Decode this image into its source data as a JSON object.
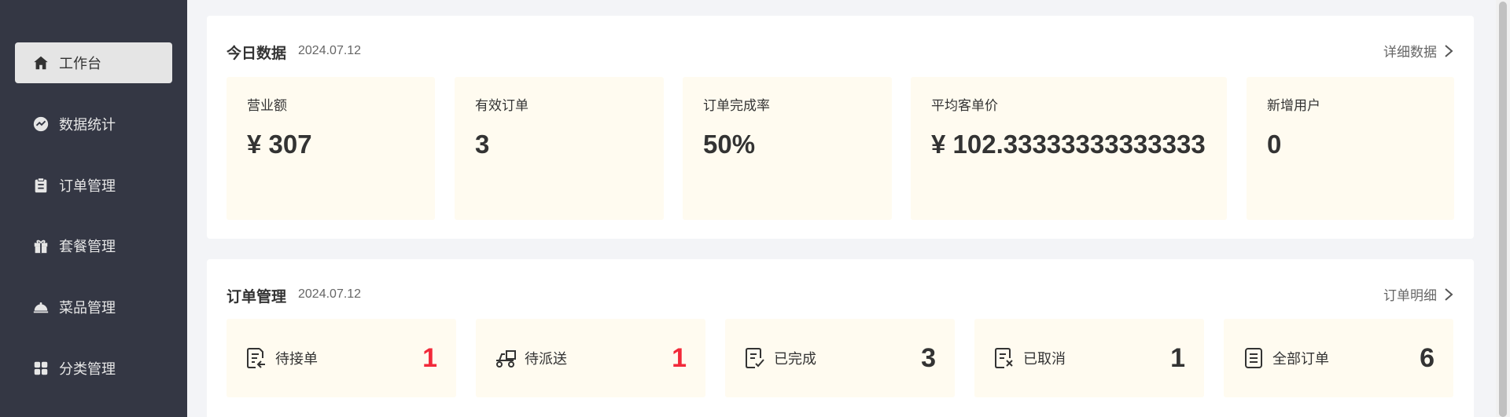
{
  "sidebar": {
    "items": [
      {
        "label": "工作台",
        "icon": "home-icon"
      },
      {
        "label": "数据统计",
        "icon": "chart-icon"
      },
      {
        "label": "订单管理",
        "icon": "clipboard-icon"
      },
      {
        "label": "套餐管理",
        "icon": "gift-icon"
      },
      {
        "label": "菜品管理",
        "icon": "dish-icon"
      },
      {
        "label": "分类管理",
        "icon": "grid-icon"
      }
    ]
  },
  "today": {
    "title": "今日数据",
    "date": "2024.07.12",
    "link": "详细数据",
    "stats": [
      {
        "label": "营业额",
        "value": "¥ 307"
      },
      {
        "label": "有效订单",
        "value": "3"
      },
      {
        "label": "订单完成率",
        "value": "50%"
      },
      {
        "label": "平均客单价",
        "value": "¥ 102.33333333333333"
      },
      {
        "label": "新增用户",
        "value": "0"
      }
    ]
  },
  "orders": {
    "title": "订单管理",
    "date": "2024.07.12",
    "link": "订单明细",
    "items": [
      {
        "label": "待接单",
        "count": "1",
        "icon": "order-accept-icon"
      },
      {
        "label": "待派送",
        "count": "1",
        "icon": "delivery-icon"
      },
      {
        "label": "已完成",
        "count": "3",
        "icon": "order-done-icon"
      },
      {
        "label": "已取消",
        "count": "1",
        "icon": "order-cancel-icon"
      },
      {
        "label": "全部订单",
        "count": "6",
        "icon": "order-all-icon"
      }
    ]
  },
  "colors": {
    "sidebar_bg": "#343744",
    "card_bg": "#fffbf0",
    "alert_red": "#f2293a"
  }
}
